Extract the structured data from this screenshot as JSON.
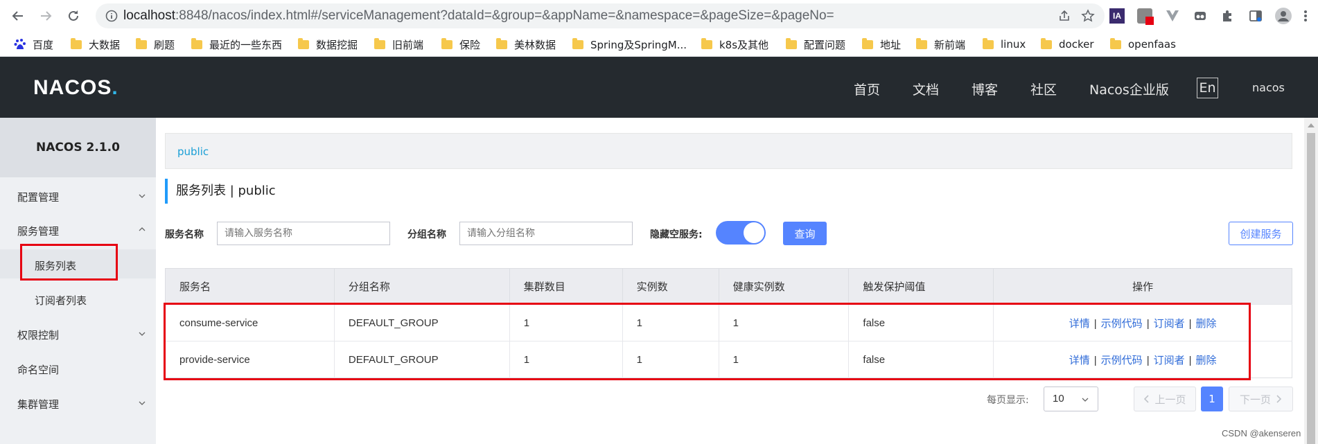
{
  "browser": {
    "url_host": "localhost",
    "url_rest": ":8848/nacos/index.html#/serviceManagement?dataId=&group=&appName=&namespace=&pageSize=&pageNo=",
    "extension_label": "IA"
  },
  "bookmarks": [
    "百度",
    "大数据",
    "刷题",
    "最近的一些东西",
    "数据挖掘",
    "旧前端",
    "保险",
    "美林数据",
    "Spring及SpringM...",
    "k8s及其他",
    "配置问题",
    "地址",
    "新前端",
    "linux",
    "docker",
    "openfaas"
  ],
  "header": {
    "logo_main": "NACOS",
    "logo_dot": ".",
    "nav": [
      "首页",
      "文档",
      "博客",
      "社区",
      "Nacos企业版"
    ],
    "lang": "En",
    "user": "nacos"
  },
  "sidebar": {
    "version": "NACOS 2.1.0",
    "items": [
      {
        "label": "配置管理"
      },
      {
        "label": "服务管理"
      },
      {
        "label": "服务列表"
      },
      {
        "label": "订阅者列表"
      },
      {
        "label": "权限控制"
      },
      {
        "label": "命名空间"
      },
      {
        "label": "集群管理"
      }
    ]
  },
  "main": {
    "namespace_tab": "public",
    "title": "服务列表  |  public",
    "filters": {
      "service_label": "服务名称",
      "service_placeholder": "请输入服务名称",
      "group_label": "分组名称",
      "group_placeholder": "请输入分组名称",
      "hide_empty_label": "隐藏空服务:",
      "query_button": "查询",
      "create_button": "创建服务"
    },
    "table": {
      "headers": [
        "服务名",
        "分组名称",
        "集群数目",
        "实例数",
        "健康实例数",
        "触发保护阈值",
        "操作"
      ],
      "rows": [
        {
          "name": "consume-service",
          "group": "DEFAULT_GROUP",
          "clusters": "1",
          "instances": "1",
          "healthy": "1",
          "threshold": "false"
        },
        {
          "name": "provide-service",
          "group": "DEFAULT_GROUP",
          "clusters": "1",
          "instances": "1",
          "healthy": "1",
          "threshold": "false"
        }
      ],
      "ops": [
        "详情",
        "示例代码",
        "订阅者",
        "删除"
      ],
      "op_separator": "|"
    },
    "pagination": {
      "per_page_label": "每页显示:",
      "per_page_value": "10",
      "prev": "上一页",
      "current": "1",
      "next": "下一页"
    }
  },
  "watermark": "CSDN @akenseren",
  "colors": {
    "header_bg": "#252a2f",
    "primary": "#5584ff",
    "link": "#2f6bd8",
    "highlight_box": "#e60012"
  }
}
